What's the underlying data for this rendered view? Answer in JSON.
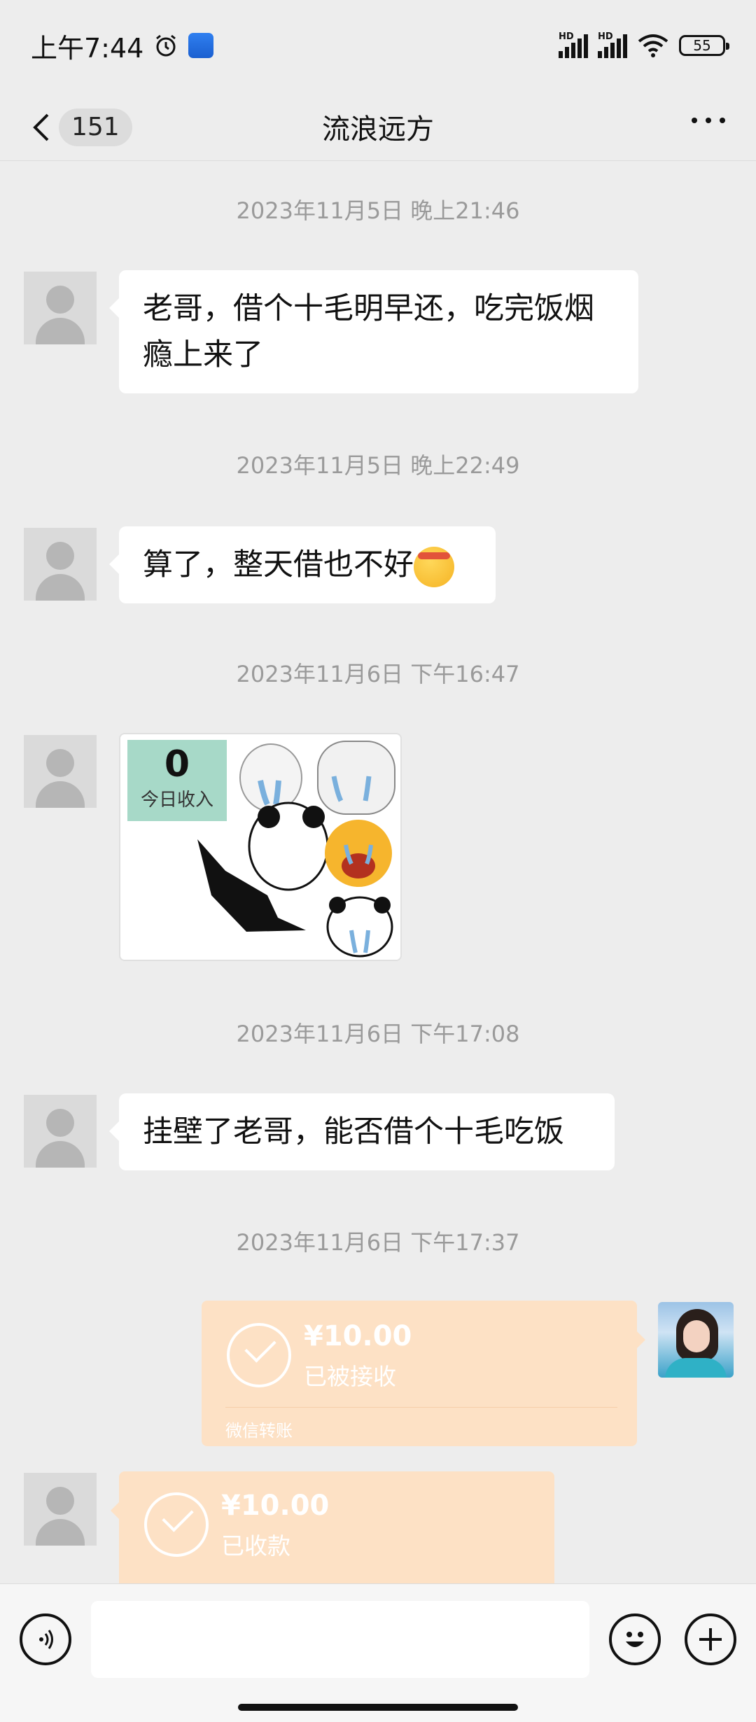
{
  "status_bar": {
    "time": "上午7:44",
    "network_1": "HD",
    "network_2": "HD",
    "battery": "55"
  },
  "nav": {
    "unread_count": "151",
    "title": "流浪远方"
  },
  "messages": {
    "ts1": "2023年11月5日 晚上21:46",
    "msg1": "老哥，借个十毛明早还，吃完饭烟瘾上来了",
    "ts2": "2023年11月5日 晚上22:49",
    "msg2": "算了，整天借也不好",
    "ts3": "2023年11月6日 下午16:47",
    "sticker": {
      "number": "0",
      "label": "今日收入"
    },
    "ts4": "2023年11月6日 下午17:08",
    "msg4": "挂壁了老哥，能否借个十毛吃饭",
    "ts5": "2023年11月6日 下午17:37"
  },
  "transfer_sent": {
    "amount": "¥10.00",
    "status": "已被接收",
    "footer": "微信转账"
  },
  "transfer_received": {
    "amount": "¥10.00",
    "status": "已收款"
  },
  "input": {
    "placeholder": ""
  },
  "colors": {
    "background": "#ededed",
    "bubble": "#ffffff",
    "transfer": "#fde1c5",
    "timestamp": "#9a9a9a"
  }
}
